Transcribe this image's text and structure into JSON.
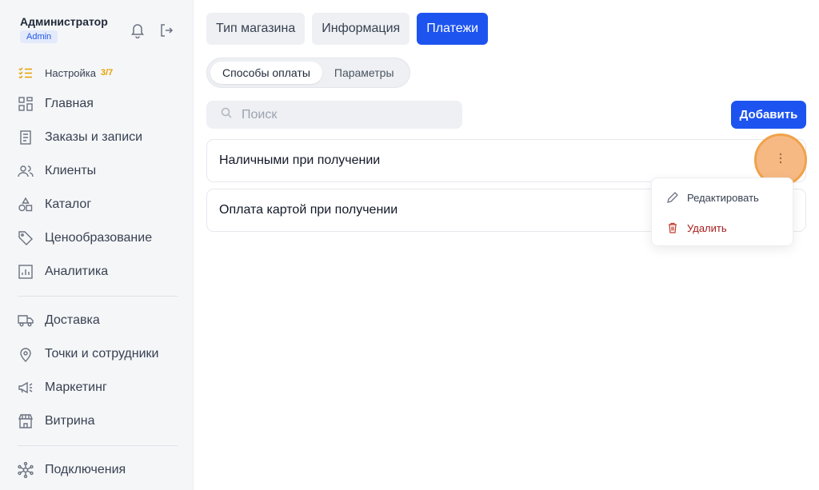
{
  "user": {
    "name": "Администратор",
    "role": "Admin"
  },
  "top_icons": {
    "bell": "bell-icon",
    "logout": "logout-icon"
  },
  "sidebar": {
    "setup": {
      "label": "Настройка",
      "count": "3/7",
      "icon": "checklist-icon"
    },
    "items": [
      {
        "label": "Главная",
        "icon": "dashboard-grid-icon"
      },
      {
        "label": "Заказы и записи",
        "icon": "receipt-icon"
      },
      {
        "label": "Клиенты",
        "icon": "users-icon"
      },
      {
        "label": "Каталог",
        "icon": "shapes-icon"
      },
      {
        "label": "Ценообразование",
        "icon": "price-tag-icon"
      },
      {
        "label": "Аналитика",
        "icon": "chart-icon"
      },
      {
        "label": "Доставка",
        "icon": "truck-icon"
      },
      {
        "label": "Точки и сотрудники",
        "icon": "map-pin-icon"
      },
      {
        "label": "Маркетинг",
        "icon": "megaphone-icon"
      },
      {
        "label": "Витрина",
        "icon": "storefront-icon"
      },
      {
        "label": "Подключения",
        "icon": "network-icon"
      }
    ]
  },
  "tabs": [
    {
      "label": "Тип магазина",
      "active": false
    },
    {
      "label": "Информация",
      "active": false
    },
    {
      "label": "Платежи",
      "active": true
    }
  ],
  "subtabs": [
    {
      "label": "Способы оплаты",
      "active": true
    },
    {
      "label": "Параметры",
      "active": false
    }
  ],
  "search": {
    "placeholder": "Поиск",
    "value": ""
  },
  "add_button": "Добавить",
  "payment_methods": [
    {
      "label": "Наличными при получении"
    },
    {
      "label": "Оплата картой при получении"
    }
  ],
  "context_menu": {
    "edit": "Редактировать",
    "delete": "Удалить"
  },
  "colors": {
    "accent": "#1d54f0",
    "setup_count": "#e6a100",
    "danger": "#a51d1d",
    "highlight": "#f0a24a"
  }
}
